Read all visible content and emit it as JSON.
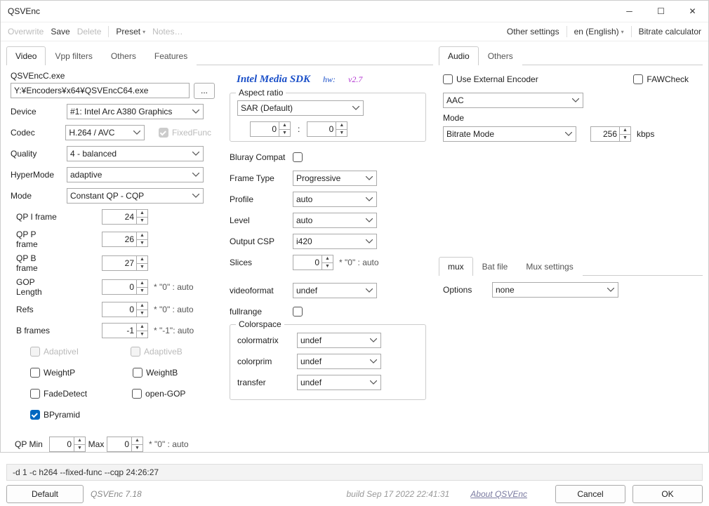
{
  "window": {
    "title": "QSVEnc"
  },
  "toolbar": {
    "overwrite": "Overwrite",
    "save": "Save",
    "delete": "Delete",
    "preset": "Preset",
    "notes": "Notes…",
    "other": "Other settings",
    "lang": "en (English)",
    "bitcalc": "Bitrate calculator"
  },
  "ltabs": {
    "video": "Video",
    "vpp": "Vpp filters",
    "others": "Others",
    "features": "Features"
  },
  "exe": {
    "label": "QSVEncC.exe",
    "path": "Y:¥Encoders¥x64¥QSVEncC64.exe",
    "browse": "..."
  },
  "sdk": {
    "title": "Intel Media SDK",
    "hw": "hw:",
    "ver": "v2.7"
  },
  "dev": {
    "label": "Device",
    "value": "#1: Intel Arc A380  Graphics"
  },
  "codec": {
    "label": "Codec",
    "value": "H.264 / AVC",
    "fixedfunc": "FixedFunc"
  },
  "quality": {
    "label": "Quality",
    "value": "4 - balanced"
  },
  "hyper": {
    "label": "HyperMode",
    "value": "adaptive"
  },
  "mode": {
    "label": "Mode",
    "value": "Constant QP - CQP"
  },
  "qpi": {
    "label": "QP I frame",
    "value": "24"
  },
  "qpp": {
    "label": "QP P frame",
    "value": "26"
  },
  "qpb": {
    "label": "QP B frame",
    "value": "27"
  },
  "gop": {
    "label": "GOP Length",
    "value": "0",
    "hint": "* \"0\" : auto"
  },
  "refs": {
    "label": "Refs",
    "value": "0",
    "hint": "* \"0\" : auto"
  },
  "bfr": {
    "label": "B frames",
    "value": "-1",
    "hint": "* \"-1\": auto"
  },
  "flags": {
    "adaptivei": "AdaptiveI",
    "adaptiveb": "AdaptiveB",
    "weightp": "WeightP",
    "weightb": "WeightB",
    "fade": "FadeDetect",
    "opengop": "open-GOP",
    "bpyr": "BPyramid"
  },
  "qpmin": {
    "label": "QP Min",
    "value": "0"
  },
  "qpmax": {
    "label": "Max",
    "value": "0",
    "hint": "* \"0\" : auto"
  },
  "aspect": {
    "legend": "Aspect ratio",
    "mode": "SAR (Default)",
    "a": "0",
    "b": "0",
    "sep": ":"
  },
  "bluray": {
    "label": "Bluray Compat"
  },
  "frametype": {
    "label": "Frame Type",
    "value": "Progressive"
  },
  "profile": {
    "label": "Profile",
    "value": "auto"
  },
  "level": {
    "label": "Level",
    "value": "auto"
  },
  "csp": {
    "label": "Output CSP",
    "value": "i420"
  },
  "slices": {
    "label": "Slices",
    "value": "0",
    "hint": "* \"0\" : auto"
  },
  "vfmt": {
    "label": "videoformat",
    "value": "undef"
  },
  "fullrange": {
    "label": "fullrange"
  },
  "cs": {
    "legend": "Colorspace",
    "matrix": {
      "label": "colormatrix",
      "value": "undef"
    },
    "prim": {
      "label": "colorprim",
      "value": "undef"
    },
    "transfer": {
      "label": "transfer",
      "value": "undef"
    }
  },
  "rtabs": {
    "audio": "Audio",
    "others": "Others"
  },
  "audio": {
    "useext": "Use External Encoder",
    "faw": "FAWCheck",
    "codec": "AAC",
    "modelabel": "Mode",
    "mode": "Bitrate Mode",
    "bitrate": "256",
    "unit": "kbps"
  },
  "btabs": {
    "mux": "mux",
    "bat": "Bat file",
    "muxs": "Mux settings"
  },
  "mux": {
    "optlabel": "Options",
    "opt": "none"
  },
  "cmdline": "-d 1 -c h264 --fixed-func --cqp 24:26:27",
  "footer": {
    "default": "Default",
    "ver": "QSVEnc 7.18",
    "build": "build Sep 17 2022 22:41:31",
    "about": "About QSVEnc",
    "cancel": "Cancel",
    "ok": "OK"
  }
}
